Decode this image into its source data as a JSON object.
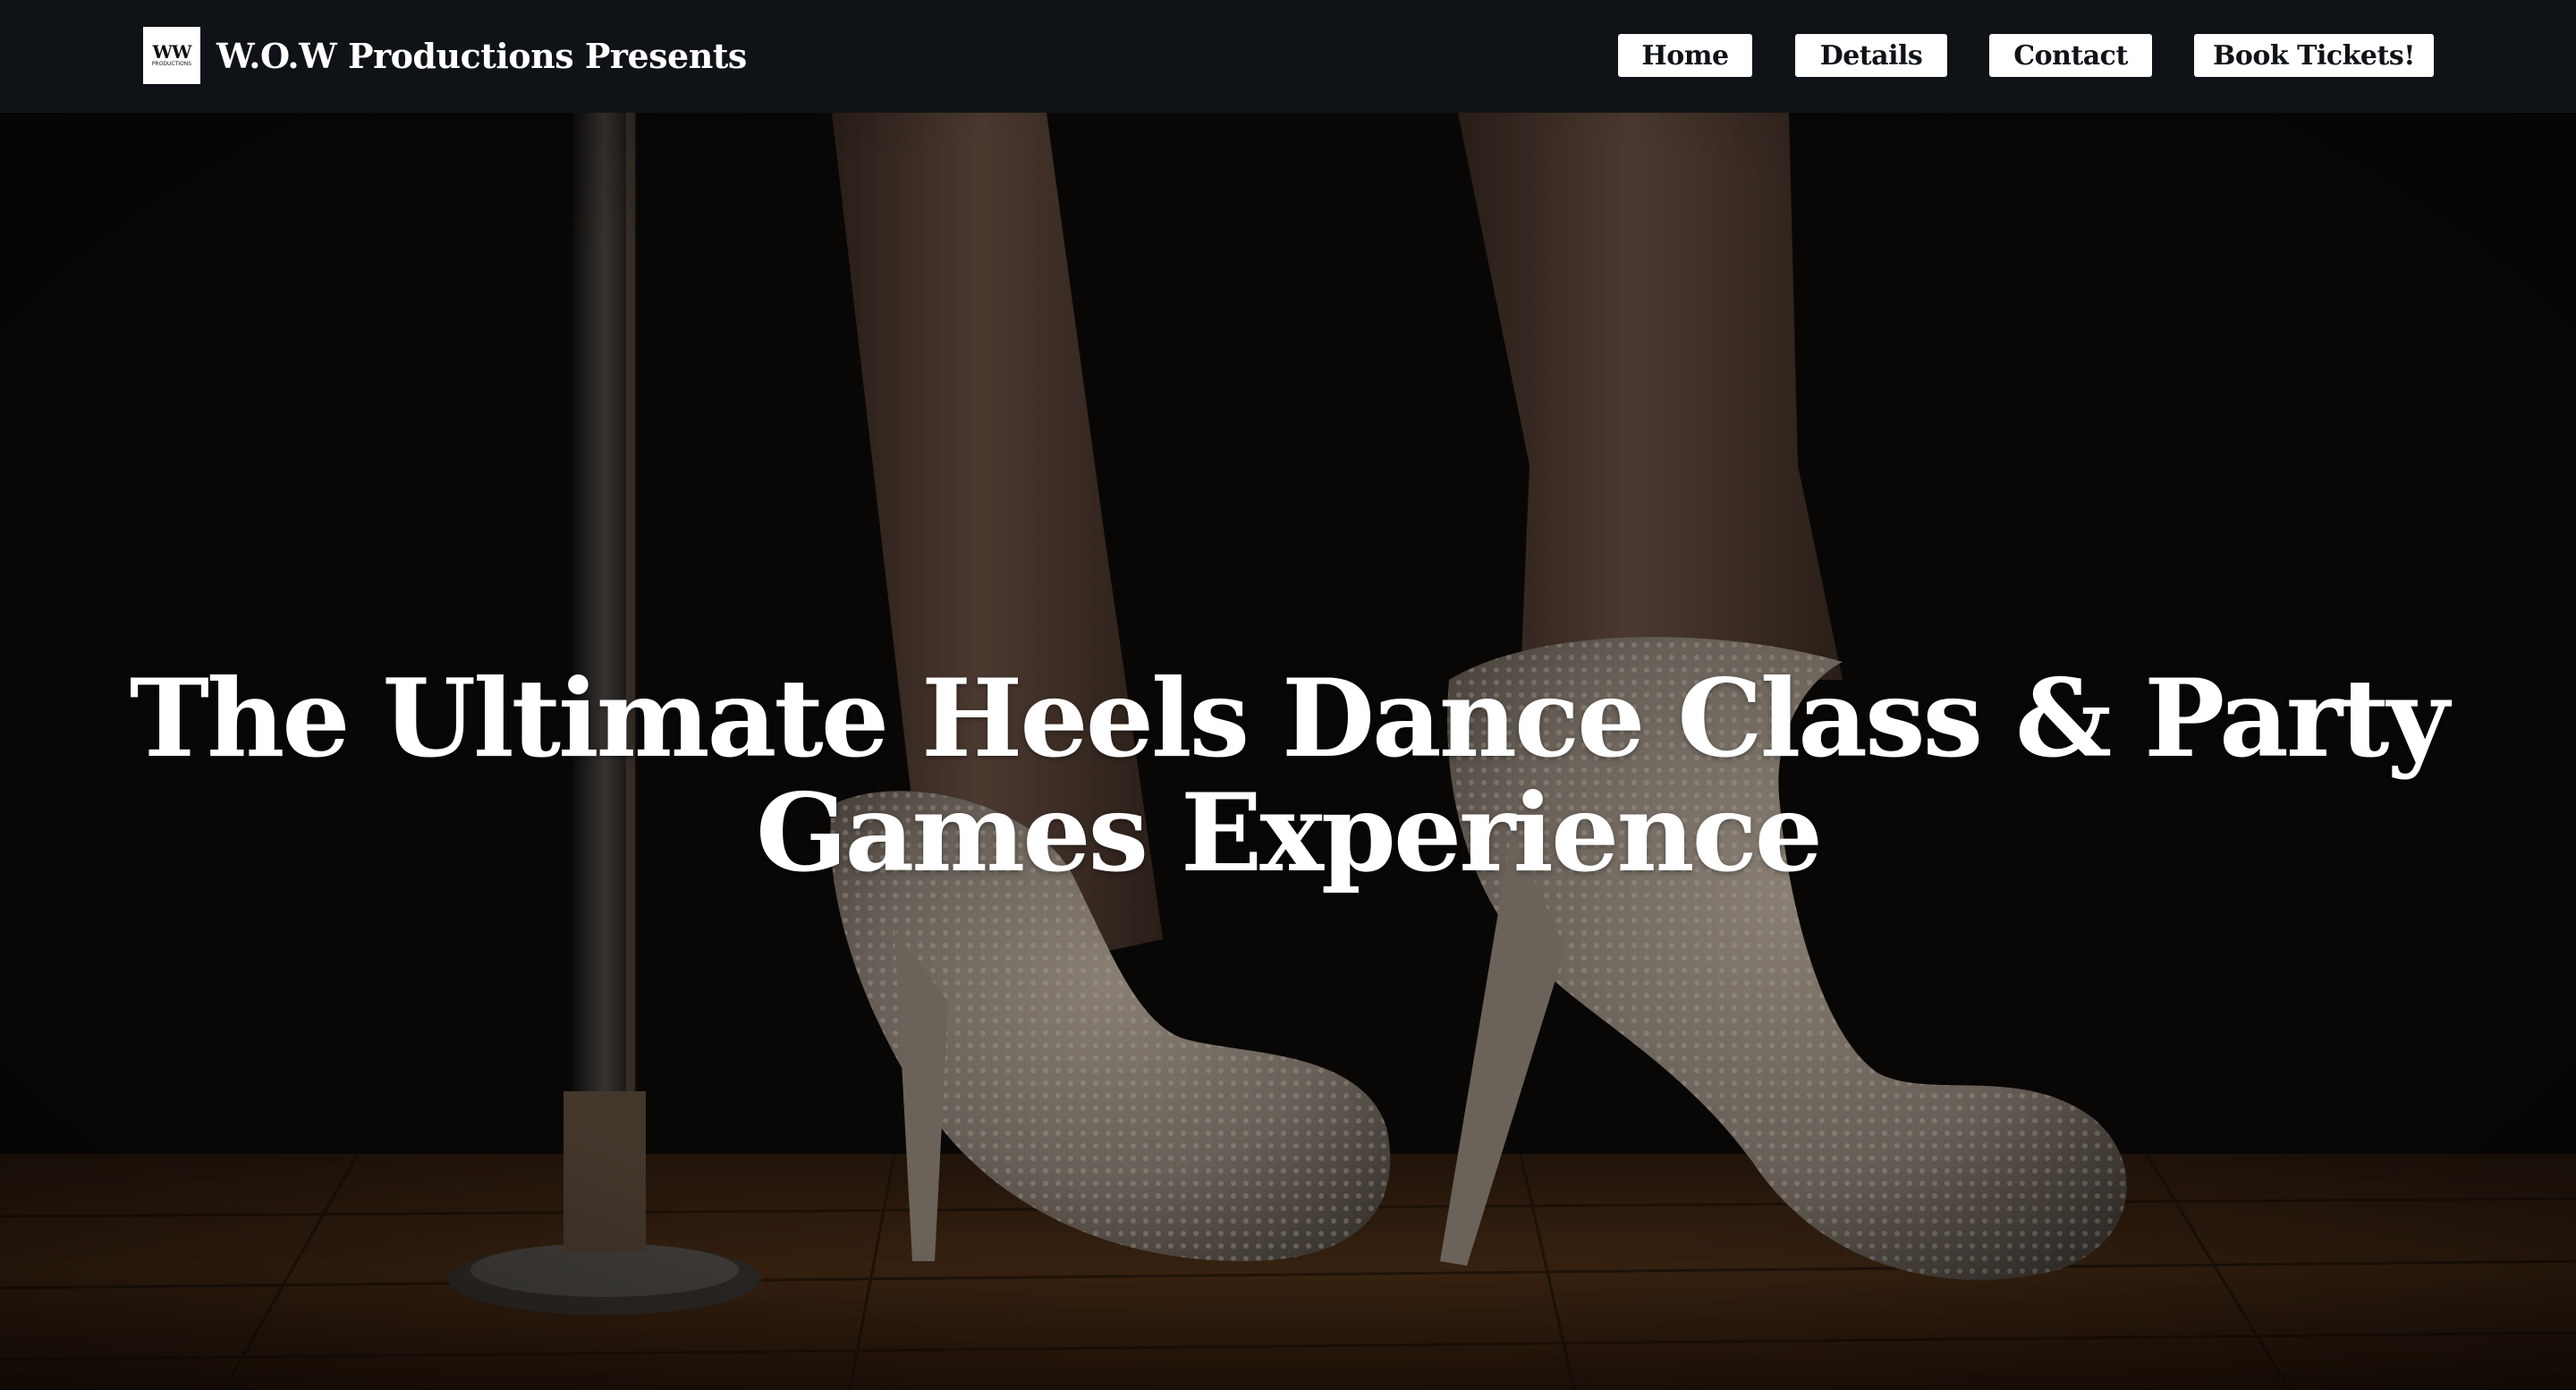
{
  "header": {
    "logo_mark": "WW",
    "logo_sub": "PRODUCTIONS",
    "brand_title": "W.O.W Productions Presents"
  },
  "nav": {
    "home": "Home",
    "details": "Details",
    "contact": "Contact",
    "book": "Book Tickets!"
  },
  "hero": {
    "headline_line1": "The Ultimate Heels Dance Class & Party",
    "headline_line2": "Games Experience",
    "image_subject": "sparkly-high-heels-on-stage-with-pole"
  },
  "colors": {
    "header_bg": "#0f1216",
    "button_bg": "#ffffff",
    "button_text": "#0f1216",
    "headline": "#ffffff"
  }
}
